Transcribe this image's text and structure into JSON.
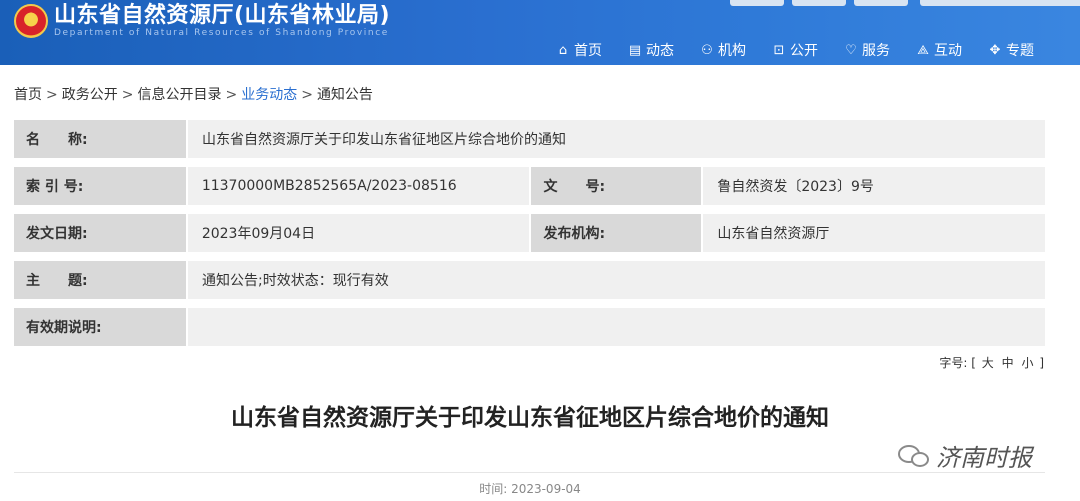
{
  "header": {
    "title": "山东省自然资源厅(山东省林业局)",
    "subtitle": "Department of Natural Resources of Shandong Province",
    "nav": [
      {
        "label": "首页",
        "icon": "home-icon",
        "glyph": "⌂"
      },
      {
        "label": "动态",
        "icon": "news-icon",
        "glyph": "▤"
      },
      {
        "label": "机构",
        "icon": "organization-icon",
        "glyph": "⚇"
      },
      {
        "label": "公开",
        "icon": "lock-icon",
        "glyph": "⊡"
      },
      {
        "label": "服务",
        "icon": "heart-icon",
        "glyph": "♡"
      },
      {
        "label": "互动",
        "icon": "interaction-icon",
        "glyph": "⟁"
      },
      {
        "label": "专题",
        "icon": "topic-icon",
        "glyph": "✥"
      }
    ]
  },
  "breadcrumb": {
    "items": [
      "首页",
      "政务公开",
      "信息公开目录",
      "业务动态",
      "通知公告"
    ],
    "separator": ">"
  },
  "info": {
    "name_label": "名　　称:",
    "name_value": "山东省自然资源厅关于印发山东省征地区片综合地价的通知",
    "index_label": "索 引 号:",
    "index_value": "11370000MB2852565A/2023-08516",
    "doc_no_label": "文　　号:",
    "doc_no_value": "鲁自然资发〔2023〕9号",
    "date_label": "发文日期:",
    "date_value": "2023年09月04日",
    "publisher_label": "发布机构:",
    "publisher_value": "山东省自然资源厅",
    "subject_label": "主　　题:",
    "subject_value": "通知公告;时效状态：现行有效",
    "validity_label": "有效期说明:",
    "validity_value": ""
  },
  "font_size": {
    "label": "字号:",
    "bracket_open": "[",
    "large": "大",
    "medium": "中",
    "small": "小",
    "bracket_close": "]"
  },
  "article": {
    "title": "山东省自然资源厅关于印发山东省征地区片综合地价的通知",
    "time_label": "时间:",
    "time_value": "2023-09-04"
  },
  "watermark": {
    "text": "济南时报",
    "icon": "wechat-icon"
  },
  "colors": {
    "header_blue": "#1a5fb8",
    "link_blue": "#2a6fd0",
    "label_bg": "#d9d9d9",
    "value_bg": "#f0f0f0"
  }
}
